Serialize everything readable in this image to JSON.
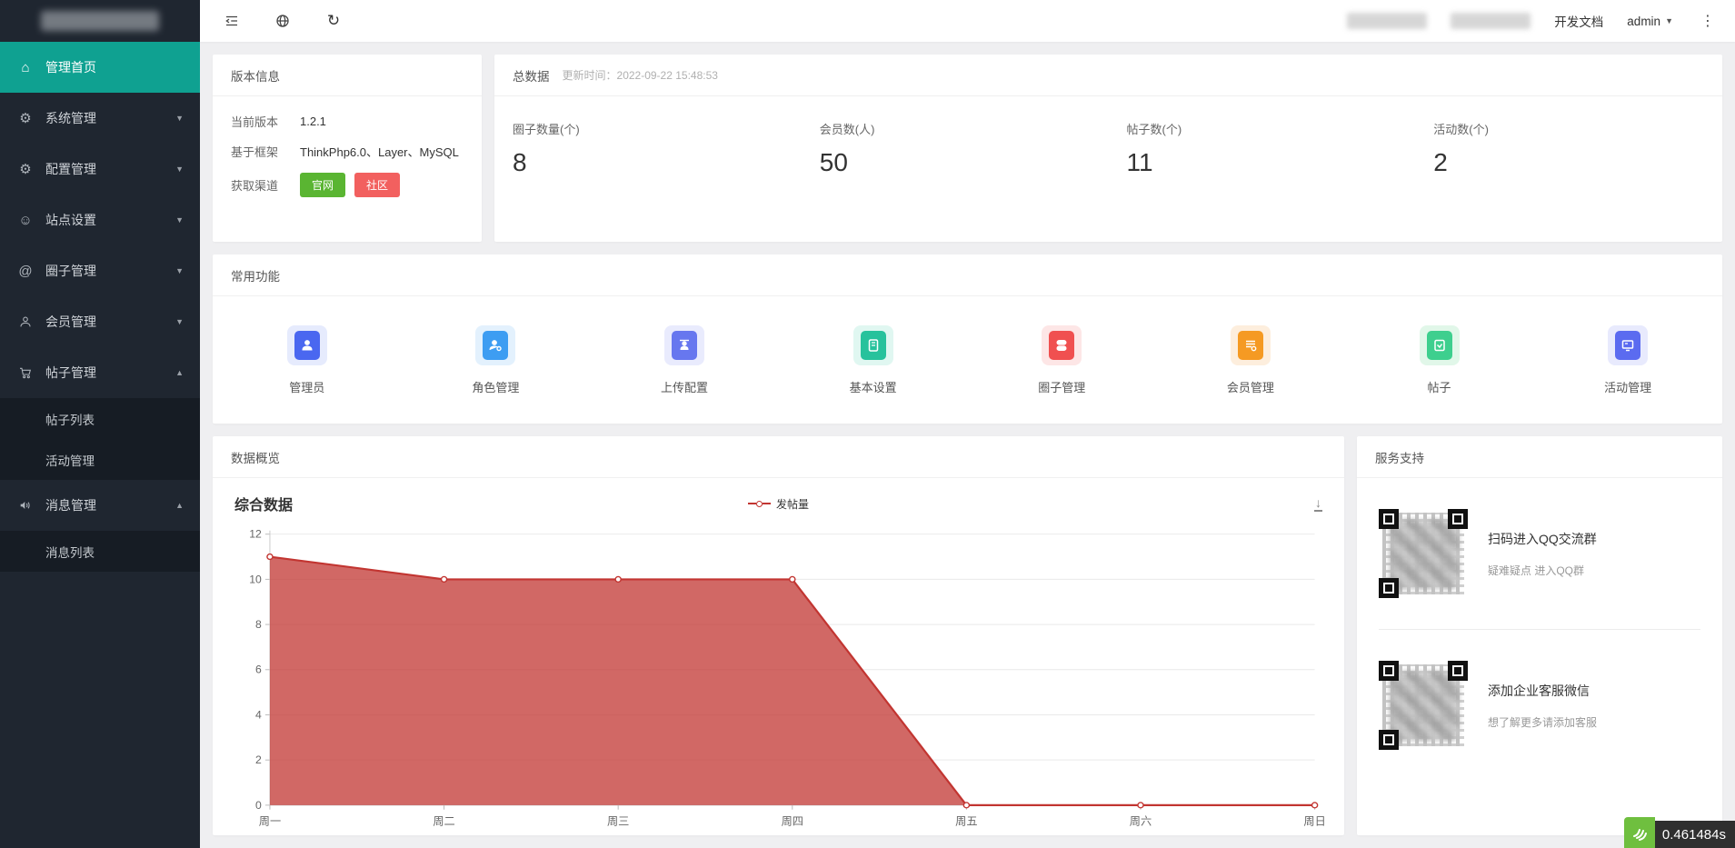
{
  "colors": {
    "accent_teal": "#0fa191",
    "sidebar_bg": "#1f2630",
    "submenu_bg": "#161c24",
    "chart_line": "#c23531",
    "chart_area": "rgba(194,53,49,0.75)",
    "btn_green": "#5ab532",
    "btn_red": "#f2605f"
  },
  "sidebar": {
    "items": [
      {
        "label": "管理首页",
        "icon": "home-icon",
        "active": true
      },
      {
        "label": "系统管理",
        "icon": "gear-icon"
      },
      {
        "label": "配置管理",
        "icon": "cog-icon"
      },
      {
        "label": "站点设置",
        "icon": "site-face-icon"
      },
      {
        "label": "圈子管理",
        "icon": "at-icon"
      },
      {
        "label": "会员管理",
        "icon": "user-icon"
      },
      {
        "label": "帖子管理",
        "icon": "cart-icon",
        "expanded": true,
        "children": [
          {
            "label": "帖子列表"
          },
          {
            "label": "活动管理"
          }
        ]
      },
      {
        "label": "消息管理",
        "icon": "speaker-icon",
        "expanded": true,
        "children": [
          {
            "label": "消息列表"
          }
        ]
      }
    ]
  },
  "topbar": {
    "doc_link": "开发文档",
    "user": "admin",
    "kebab": "⋮"
  },
  "version_panel": {
    "title": "版本信息",
    "rows": [
      {
        "label": "当前版本",
        "value": "1.2.1"
      },
      {
        "label": "基于框架",
        "value": "ThinkPhp6.0、Layer、MySQL"
      }
    ],
    "channel_label": "获取渠道",
    "channels": [
      {
        "label": "官网",
        "color": "#5ab532"
      },
      {
        "label": "社区",
        "color": "#f2605f"
      }
    ]
  },
  "stats_panel": {
    "title": "总数据",
    "updated_label": "更新时间：",
    "updated_time": "2022-09-22 15:48:53",
    "stats": [
      {
        "label": "圈子数量(个)",
        "value": "8"
      },
      {
        "label": "会员数(人)",
        "value": "50"
      },
      {
        "label": "帖子数(个)",
        "value": "11"
      },
      {
        "label": "活动数(个)",
        "value": "2"
      }
    ]
  },
  "quick_panel": {
    "title": "常用功能",
    "items": [
      {
        "label": "管理员",
        "color": "#4a67f0"
      },
      {
        "label": "角色管理",
        "color": "#3d9df2"
      },
      {
        "label": "上传配置",
        "color": "#6777ef"
      },
      {
        "label": "基本设置",
        "color": "#27c29c"
      },
      {
        "label": "圈子管理",
        "color": "#f05050"
      },
      {
        "label": "会员管理",
        "color": "#f59a23"
      },
      {
        "label": "帖子",
        "color": "#3ecf8e"
      },
      {
        "label": "活动管理",
        "color": "#5b6bf0"
      }
    ]
  },
  "overview_panel": {
    "title": "数据概览",
    "chart_title": "综合数据",
    "legend": "发帖量"
  },
  "chart_data": {
    "type": "area",
    "title": "综合数据",
    "series_name": "发帖量",
    "categories": [
      "周一",
      "周二",
      "周三",
      "周四",
      "周五",
      "周六",
      "周日"
    ],
    "values": [
      11,
      10,
      10,
      10,
      0,
      0,
      0
    ],
    "ylim": [
      0,
      12
    ],
    "yticks": [
      0,
      2,
      4,
      6,
      8,
      10,
      12
    ],
    "grid": true,
    "legend_position": "top-center",
    "line_color": "#c23531",
    "area_color": "rgba(194,53,49,0.75)"
  },
  "support_panel": {
    "title": "服务支持",
    "sections": [
      {
        "title": "扫码进入QQ交流群",
        "subtitle": "疑难疑点 进入QQ群"
      },
      {
        "title": "添加企业客服微信",
        "subtitle": "想了解更多请添加客服"
      }
    ]
  },
  "debug_badge": {
    "time": "0.461484s"
  }
}
